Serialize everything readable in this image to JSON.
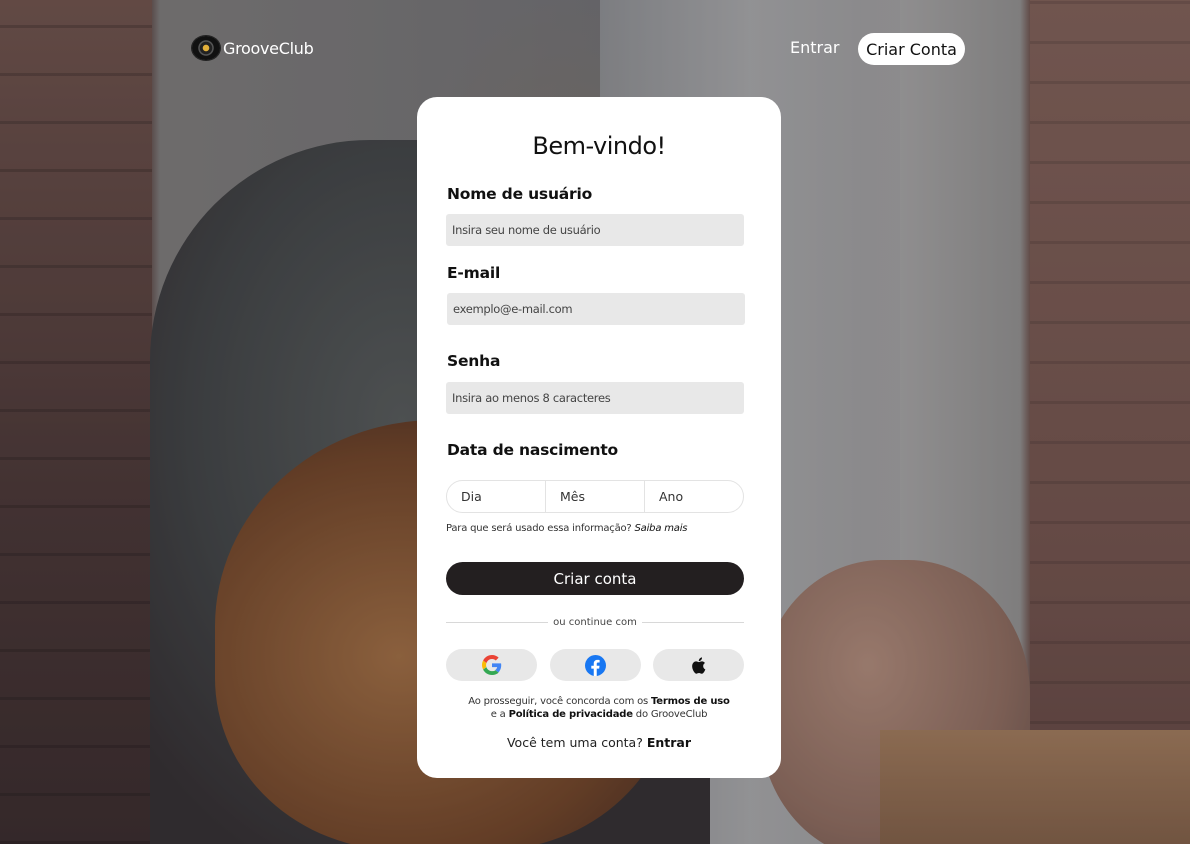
{
  "brand": {
    "name": "GrooveClub"
  },
  "nav": {
    "login_label": "Entrar",
    "signup_label": "Criar Conta"
  },
  "form": {
    "title": "Bem-vindo!",
    "username": {
      "label": "Nome de usuário",
      "placeholder": "Insira seu nome de usuário"
    },
    "email": {
      "label": "E-mail",
      "placeholder": "exemplo@e-mail.com"
    },
    "password": {
      "label": "Senha",
      "placeholder": "Insira ao menos 8 caracteres"
    },
    "birthdate": {
      "label": "Data de nascimento",
      "day": "Dia",
      "month": "Mês",
      "year": "Ano",
      "help_text": "Para que será usado essa informação?",
      "help_link": "Saiba mais"
    },
    "submit_label": "Criar conta",
    "divider_text": "ou continue com",
    "social": {
      "google_icon": "google-icon",
      "facebook_icon": "facebook-icon",
      "apple_icon": "apple-icon"
    },
    "terms": {
      "line1_prefix": "Ao prosseguir, você concorda com os",
      "terms_link": "Termos de uso",
      "line2_prefix": "e a",
      "privacy_link": "Política de privacidade",
      "line2_suffix": "do GrooveClub"
    },
    "login_prompt": {
      "text": "Você tem uma conta?",
      "link": "Entrar"
    }
  },
  "colors": {
    "primary_button": "#231f20",
    "field_bg": "#e8e8e8",
    "card_bg": "#ffffff",
    "facebook": "#1877f2"
  }
}
